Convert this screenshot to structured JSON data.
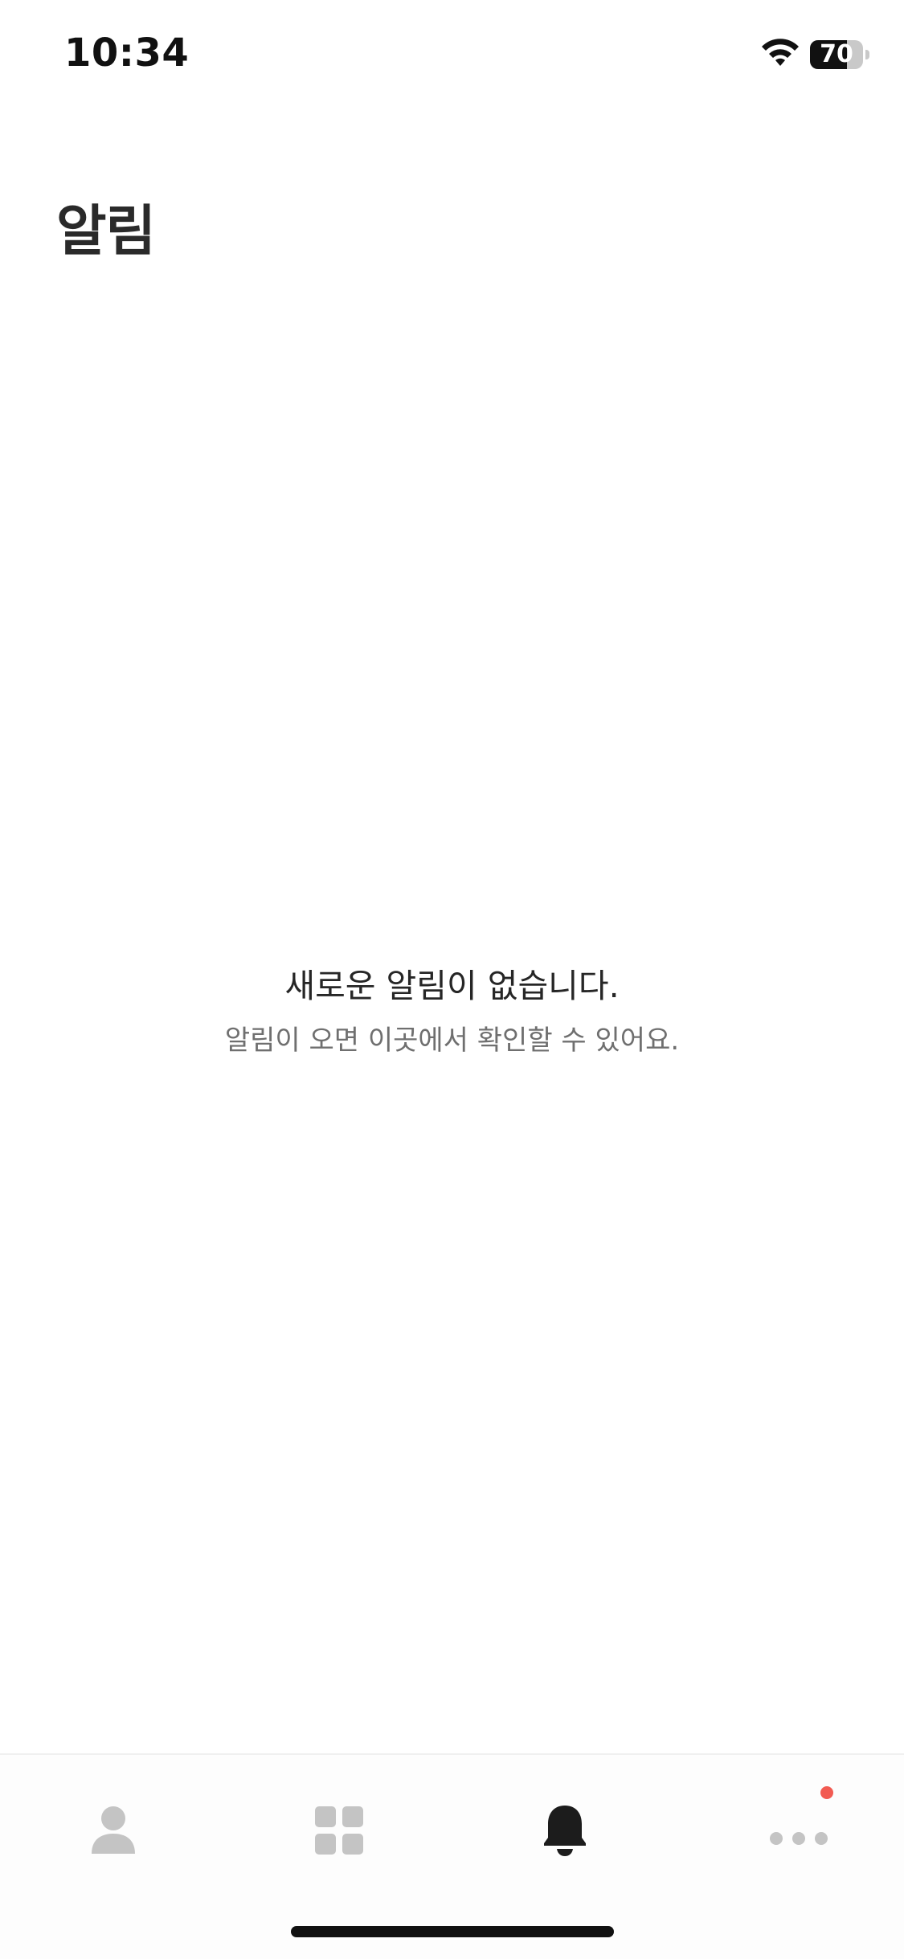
{
  "status_bar": {
    "time": "10:34",
    "battery_level": "70",
    "battery_fraction": 0.7
  },
  "header": {
    "title": "알림"
  },
  "empty_state": {
    "title": "새로운 알림이 없습니다.",
    "subtitle": "알림이 오면 이곳에서 확인할 수 있어요."
  },
  "tab_bar": {
    "tabs": [
      {
        "icon": "person-icon",
        "active": false
      },
      {
        "icon": "grid-icon",
        "active": false
      },
      {
        "icon": "bell-icon",
        "active": true
      },
      {
        "icon": "more-icon",
        "active": false,
        "badge": true
      }
    ],
    "active_color": "#1c1c1c",
    "inactive_color": "#c4c4c4",
    "badge_color": "#f25b52"
  }
}
